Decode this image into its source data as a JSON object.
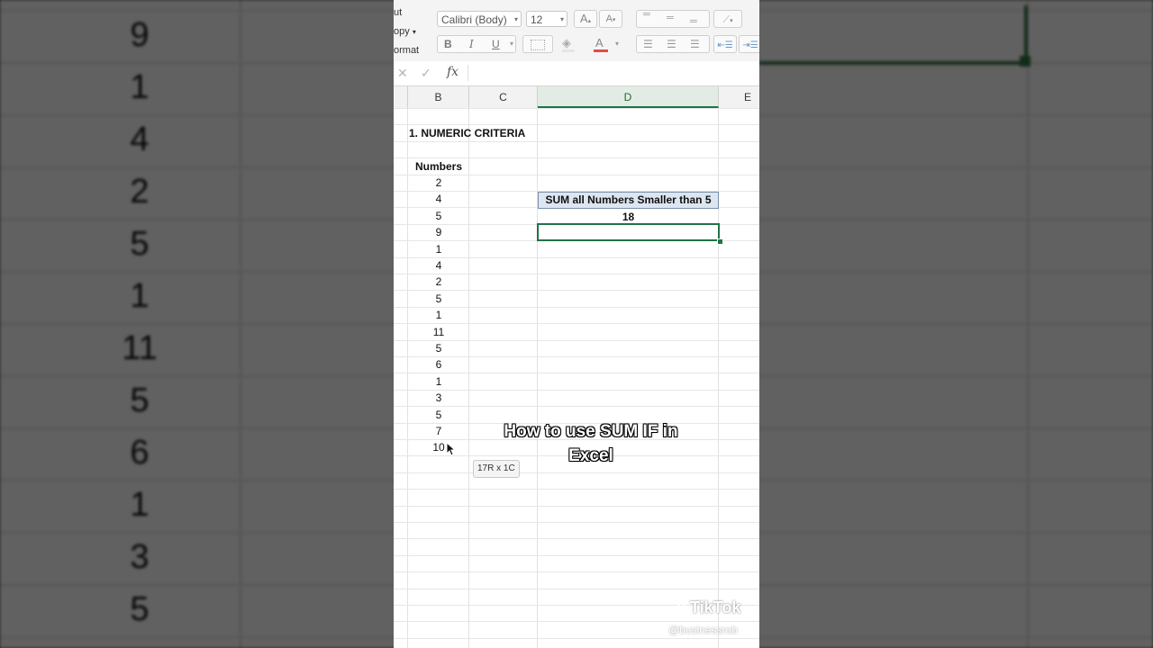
{
  "background": {
    "numbers": [
      "9",
      "1",
      "4",
      "2",
      "5",
      "1",
      "11",
      "5",
      "6",
      "1",
      "3",
      "5"
    ]
  },
  "ribbon": {
    "clipboard_items": [
      "ut",
      "opy",
      "ormat"
    ],
    "font_name": "Calibri (Body)",
    "font_size": "12",
    "bold_label": "B",
    "italic_label": "I",
    "underline_label": "U",
    "increase_font_label": "A",
    "decrease_font_label": "A",
    "font_color_label": "A"
  },
  "formula_bar": {
    "cancel_icon": "✕",
    "enter_icon": "✓",
    "fx_label": "fx",
    "value": ""
  },
  "columns": [
    "B",
    "C",
    "D",
    "E"
  ],
  "sheet": {
    "section_title": "1. NUMERIC CRITERIA",
    "numbers_header": "Numbers",
    "numbers": [
      "2",
      "4",
      "5",
      "9",
      "1",
      "4",
      "2",
      "5",
      "1",
      "11",
      "5",
      "6",
      "1",
      "3",
      "5",
      "7",
      "10"
    ],
    "sum_label": "SUM all Numbers Smaller than 5",
    "sum_value": "18"
  },
  "selection_tooltip": "17R x 1C",
  "caption": {
    "line1": "How to use SUM IF in",
    "line2": "Excel"
  },
  "watermark": {
    "brand": "TikTok",
    "handle": "@businessrob"
  },
  "colors": {
    "excel_green": "#217346",
    "header_fill": "#dce6f1"
  }
}
